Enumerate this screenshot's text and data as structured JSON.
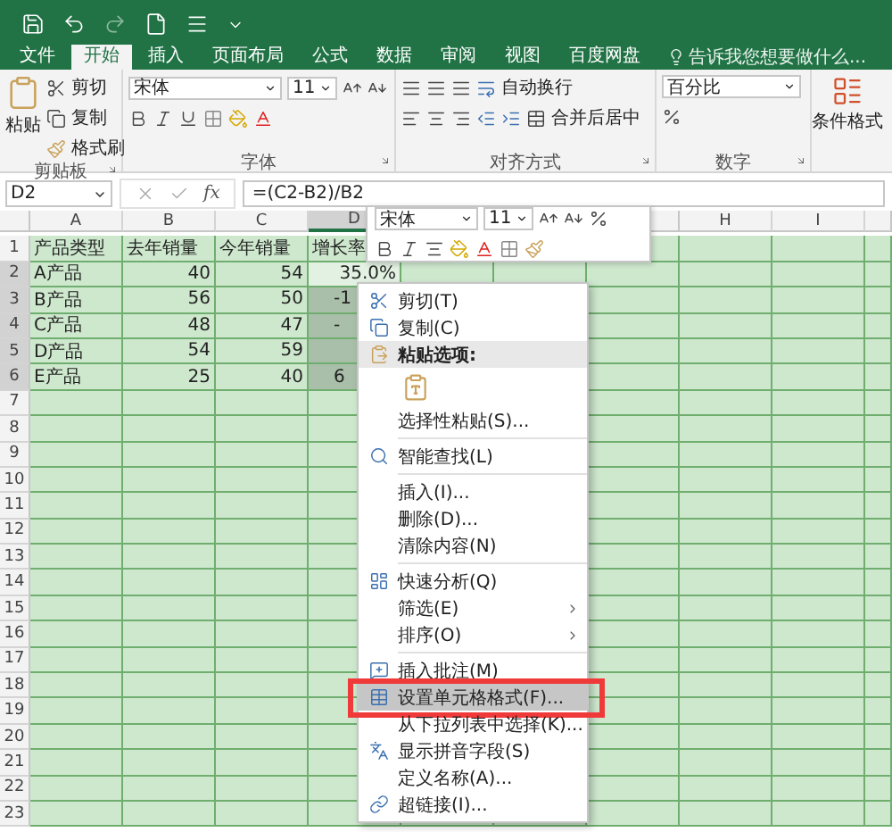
{
  "tabs": [
    {
      "label": "文件",
      "selected": false
    },
    {
      "label": "开始",
      "selected": true
    },
    {
      "label": "插入",
      "selected": false
    },
    {
      "label": "页面布局",
      "selected": false
    },
    {
      "label": "公式",
      "selected": false
    },
    {
      "label": "数据",
      "selected": false
    },
    {
      "label": "审阅",
      "selected": false
    },
    {
      "label": "视图",
      "selected": false
    },
    {
      "label": "百度网盘",
      "selected": false
    }
  ],
  "tell_me": "告诉我您想要做什么...",
  "ribbon": {
    "clipboard": {
      "title": "剪贴板",
      "paste": "粘贴",
      "cut": "剪切",
      "copy": "复制",
      "format_painter": "格式刷"
    },
    "font": {
      "title": "字体",
      "font_name": "宋体",
      "font_size": "11"
    },
    "alignment": {
      "title": "对齐方式",
      "wrap": "自动换行",
      "merge": "合并后居中"
    },
    "number": {
      "title": "数字",
      "format": "百分比"
    },
    "styles": {
      "conditional": "条件格式"
    }
  },
  "formula_bar": {
    "name_box": "D2",
    "function_label": "fx",
    "formula": "=(C2-B2)/B2"
  },
  "columns": [
    {
      "kind": "header",
      "label": "A"
    },
    {
      "kind": "header",
      "label": "B"
    },
    {
      "kind": "header",
      "label": "C"
    },
    {
      "kind": "header",
      "label": "D"
    },
    {
      "kind": "covered"
    },
    {
      "kind": "covered"
    },
    {
      "kind": "covered"
    },
    {
      "kind": "header",
      "label": "H"
    },
    {
      "kind": "header",
      "label": "I"
    }
  ],
  "rows": [
    {
      "number": "1",
      "cells": [
        {
          "text": "产品类型",
          "kind": "text",
          "selected": false
        },
        {
          "text": "去年销量",
          "kind": "text",
          "selected": false
        },
        {
          "text": "今年销量",
          "kind": "text",
          "selected": false
        },
        {
          "text": "增长率",
          "kind": "text",
          "selected": false
        }
      ]
    },
    {
      "number": "2",
      "cells": [
        {
          "text": "A产品",
          "kind": "text",
          "selected": false
        },
        {
          "text": "40",
          "kind": "number",
          "selected": false
        },
        {
          "text": "54",
          "kind": "number",
          "selected": false
        },
        {
          "text": "35.0%",
          "kind": "number",
          "selected": true
        }
      ]
    },
    {
      "number": "3",
      "cells": [
        {
          "text": "B产品",
          "kind": "text",
          "selected": false
        },
        {
          "text": "56",
          "kind": "number",
          "selected": false
        },
        {
          "text": "50",
          "kind": "number",
          "selected": false
        },
        {
          "text": "-1",
          "kind": "partial",
          "selected": true
        }
      ]
    },
    {
      "number": "4",
      "cells": [
        {
          "text": "C产品",
          "kind": "text",
          "selected": false
        },
        {
          "text": "48",
          "kind": "number",
          "selected": false
        },
        {
          "text": "47",
          "kind": "number",
          "selected": false
        },
        {
          "text": "-",
          "kind": "partial",
          "selected": true
        }
      ]
    },
    {
      "number": "5",
      "cells": [
        {
          "text": "D产品",
          "kind": "text",
          "selected": false
        },
        {
          "text": "54",
          "kind": "number",
          "selected": false
        },
        {
          "text": "59",
          "kind": "number",
          "selected": false
        },
        {
          "kind": "partial",
          "selected": true
        }
      ]
    },
    {
      "number": "6",
      "cells": [
        {
          "text": "E产品",
          "kind": "text",
          "selected": false
        },
        {
          "text": "25",
          "kind": "number",
          "selected": false
        },
        {
          "text": "40",
          "kind": "number",
          "selected": false
        },
        {
          "text": "6",
          "kind": "partial",
          "selected": true
        }
      ]
    },
    {
      "number": "7"
    },
    {
      "number": "8"
    },
    {
      "number": "9"
    },
    {
      "number": "10"
    },
    {
      "number": "11"
    },
    {
      "number": "12"
    },
    {
      "number": "13"
    },
    {
      "number": "14"
    },
    {
      "number": "15"
    },
    {
      "number": "16"
    },
    {
      "number": "17"
    },
    {
      "number": "18"
    },
    {
      "number": "19"
    },
    {
      "number": "20"
    },
    {
      "number": "21"
    },
    {
      "number": "22"
    },
    {
      "number": "23"
    }
  ],
  "mini_toolbar": {
    "font_name": "宋体",
    "font_size": "11"
  },
  "context_menu": [
    {
      "kind": "command",
      "label": "剪切(T)",
      "selected": false
    },
    {
      "kind": "command",
      "label": "复制(C)",
      "selected": false
    },
    {
      "kind": "header",
      "label": "粘贴选项:"
    },
    {
      "kind": "paste_option"
    },
    {
      "kind": "command",
      "label": "选择性粘贴(S)...",
      "selected": false
    },
    {
      "kind": "separator"
    },
    {
      "kind": "command",
      "label": "智能查找(L)",
      "selected": false
    },
    {
      "kind": "separator"
    },
    {
      "kind": "command",
      "label": "插入(I)...",
      "selected": false
    },
    {
      "kind": "command",
      "label": "删除(D)...",
      "selected": false
    },
    {
      "kind": "command",
      "label": "清除内容(N)",
      "selected": false
    },
    {
      "kind": "separator"
    },
    {
      "kind": "command",
      "label": "快速分析(Q)",
      "selected": false
    },
    {
      "kind": "submenu",
      "label": "筛选(E)",
      "selected": false
    },
    {
      "kind": "submenu",
      "label": "排序(O)",
      "selected": false
    },
    {
      "kind": "separator"
    },
    {
      "kind": "command",
      "label": "插入批注(M)",
      "selected": false
    },
    {
      "kind": "command",
      "label": "设置单元格格式(F)...",
      "selected": true
    },
    {
      "kind": "command",
      "label": "从下拉列表中选择(K)...",
      "selected": false
    },
    {
      "kind": "command",
      "label": "显示拼音字段(S)",
      "selected": false
    },
    {
      "kind": "command",
      "label": "定义名称(A)...",
      "selected": false
    },
    {
      "kind": "command",
      "label": "超链接(I)...",
      "selected": false
    }
  ]
}
